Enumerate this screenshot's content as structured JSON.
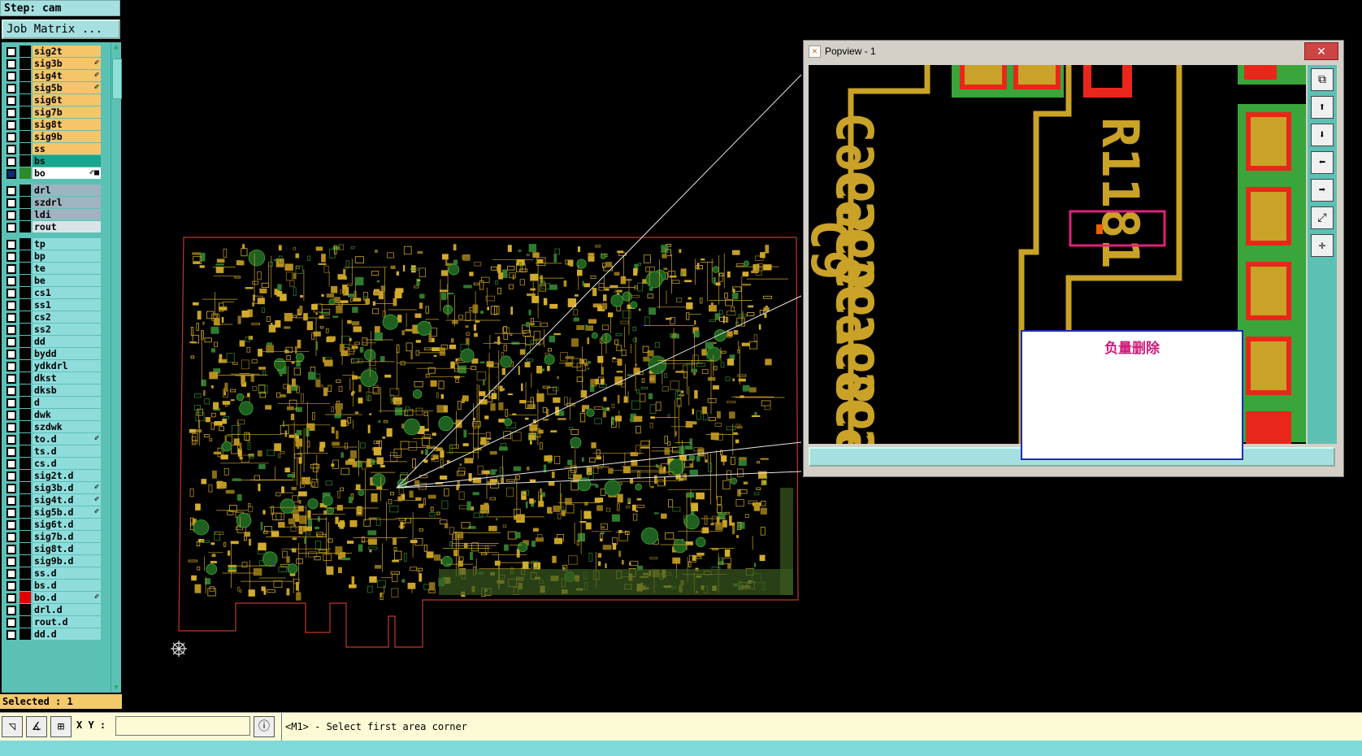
{
  "step": "Step: cam",
  "job_matrix": "Job Matrix ...",
  "layers": [
    {
      "name": "sig2t",
      "color": "#f5c56a",
      "mark": ""
    },
    {
      "name": "sig3b",
      "color": "#f5c56a",
      "mark": "✐"
    },
    {
      "name": "sig4t",
      "color": "#f5c56a",
      "mark": "✐"
    },
    {
      "name": "sig5b",
      "color": "#f5c56a",
      "mark": "✐"
    },
    {
      "name": "sig6t",
      "color": "#f5c56a",
      "mark": ""
    },
    {
      "name": "sig7b",
      "color": "#f5c56a",
      "mark": ""
    },
    {
      "name": "sig8t",
      "color": "#f5c56a",
      "mark": ""
    },
    {
      "name": "sig9b",
      "color": "#f5c56a",
      "mark": ""
    },
    {
      "name": "ss",
      "color": "#f5c56a",
      "mark": ""
    },
    {
      "name": "bs",
      "color": "#17a58c",
      "mark": ""
    },
    {
      "name": "bo",
      "color": "#ffffff",
      "mark": "✐■",
      "active": true
    },
    {
      "name": "drl",
      "color": "#9fb4c0",
      "mark": ""
    },
    {
      "name": "szdrl",
      "color": "#9fb4c0",
      "mark": ""
    },
    {
      "name": "ldi",
      "color": "#9fb4c0",
      "mark": ""
    },
    {
      "name": "rout",
      "color": "#d9e4e8",
      "mark": ""
    },
    {
      "name": "tp",
      "color": "#8fdcdc",
      "mark": ""
    },
    {
      "name": "bp",
      "color": "#8fdcdc",
      "mark": ""
    },
    {
      "name": "te",
      "color": "#8fdcdc",
      "mark": ""
    },
    {
      "name": "be",
      "color": "#8fdcdc",
      "mark": ""
    },
    {
      "name": "cs1",
      "color": "#8fdcdc",
      "mark": ""
    },
    {
      "name": "ss1",
      "color": "#8fdcdc",
      "mark": ""
    },
    {
      "name": "cs2",
      "color": "#8fdcdc",
      "mark": ""
    },
    {
      "name": "ss2",
      "color": "#8fdcdc",
      "mark": ""
    },
    {
      "name": "dd",
      "color": "#8fdcdc",
      "mark": ""
    },
    {
      "name": "bydd",
      "color": "#8fdcdc",
      "mark": ""
    },
    {
      "name": "ydkdrl",
      "color": "#8fdcdc",
      "mark": ""
    },
    {
      "name": "dkst",
      "color": "#8fdcdc",
      "mark": ""
    },
    {
      "name": "dksb",
      "color": "#8fdcdc",
      "mark": ""
    },
    {
      "name": "d",
      "color": "#8fdcdc",
      "mark": ""
    },
    {
      "name": "dwk",
      "color": "#8fdcdc",
      "mark": ""
    },
    {
      "name": "szdwk",
      "color": "#8fdcdc",
      "mark": ""
    },
    {
      "name": "to.d",
      "color": "#8fdcdc",
      "mark": "✐"
    },
    {
      "name": "ts.d",
      "color": "#8fdcdc",
      "mark": ""
    },
    {
      "name": "cs.d",
      "color": "#8fdcdc",
      "mark": ""
    },
    {
      "name": "sig2t.d",
      "color": "#8fdcdc",
      "mark": ""
    },
    {
      "name": "sig3b.d",
      "color": "#8fdcdc",
      "mark": "✐"
    },
    {
      "name": "sig4t.d",
      "color": "#8fdcdc",
      "mark": "✐"
    },
    {
      "name": "sig5b.d",
      "color": "#8fdcdc",
      "mark": "✐"
    },
    {
      "name": "sig6t.d",
      "color": "#8fdcdc",
      "mark": ""
    },
    {
      "name": "sig7b.d",
      "color": "#8fdcdc",
      "mark": ""
    },
    {
      "name": "sig8t.d",
      "color": "#8fdcdc",
      "mark": ""
    },
    {
      "name": "sig9b.d",
      "color": "#8fdcdc",
      "mark": ""
    },
    {
      "name": "ss.d",
      "color": "#8fdcdc",
      "mark": ""
    },
    {
      "name": "bs.d",
      "color": "#8fdcdc",
      "mark": ""
    },
    {
      "name": "bo.d",
      "color": "#8fdcdc",
      "mark": "✐",
      "swatch": "#e00000"
    },
    {
      "name": "drl.d",
      "color": "#8fdcdc",
      "mark": ""
    },
    {
      "name": "rout.d",
      "color": "#8fdcdc",
      "mark": ""
    },
    {
      "name": "dd.d",
      "color": "#8fdcdc",
      "mark": ""
    }
  ],
  "selected": "Selected : 1",
  "bottom": {
    "xy_label": "X Y :",
    "xy_value": "",
    "status": "<M1> - Select first area corner"
  },
  "popview": {
    "title": "Popview - 1",
    "close_x": "✕",
    "close_label": "close",
    "note": "负量删除",
    "refdes": [
      "C965",
      "C966",
      "C967",
      "C968",
      "C969",
      "C970"
    ],
    "ref_right": "R1181"
  },
  "colors": {
    "trace": "#c9a227",
    "board_outline": "#c0392b",
    "pad_green": "#3aa53a",
    "pad_red": "#e8271a"
  }
}
